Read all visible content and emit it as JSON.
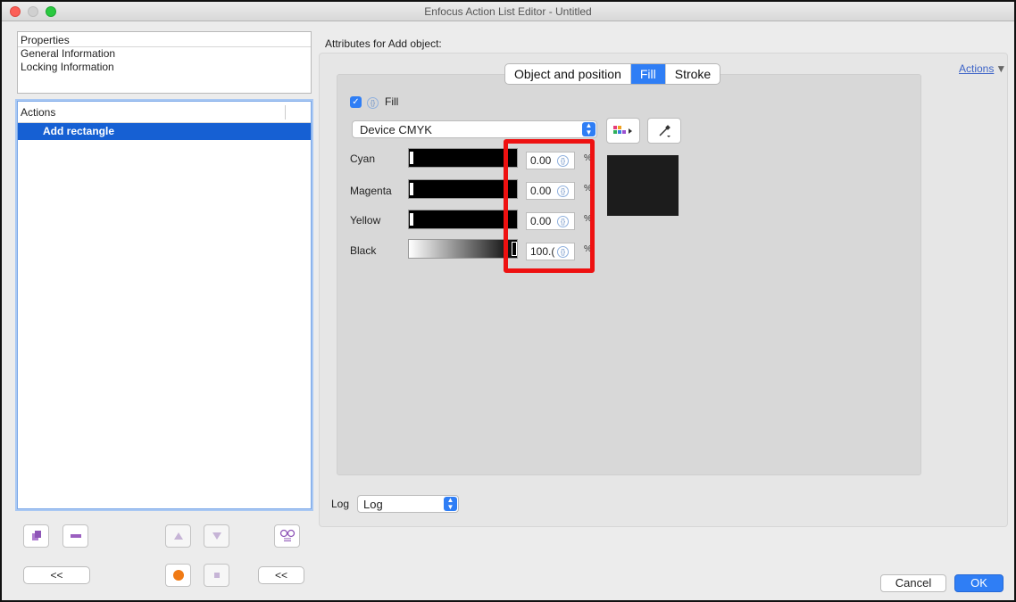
{
  "window": {
    "title": "Enfocus Action List Editor - Untitled"
  },
  "properties": {
    "header": "Properties",
    "items": [
      "General Information",
      "Locking Information"
    ]
  },
  "actions_list": {
    "header": "Actions",
    "items": [
      {
        "label": "Add rectangle",
        "selected": true
      }
    ]
  },
  "bottom_left": {
    "collapse_left": "<<",
    "collapse_right": "<<"
  },
  "panel": {
    "heading": "Attributes for Add object:",
    "actions_menu": "Actions",
    "tabs": [
      {
        "label": "Object and position",
        "active": false
      },
      {
        "label": "Fill",
        "active": true
      },
      {
        "label": "Stroke",
        "active": false
      }
    ],
    "fill": {
      "checked": true,
      "label": "Fill"
    },
    "color_space": "Device CMYK",
    "channels": [
      {
        "label": "Cyan",
        "value": "0.00",
        "unit": "%"
      },
      {
        "label": "Magenta",
        "value": "0.00",
        "unit": "%"
      },
      {
        "label": "Yellow",
        "value": "0.00",
        "unit": "%"
      },
      {
        "label": "Black",
        "value": "100.(",
        "unit": "%"
      }
    ],
    "swatch_color": "#1c1c1c"
  },
  "log": {
    "label": "Log",
    "value": "Log"
  },
  "dialog_buttons": {
    "cancel": "Cancel",
    "ok": "OK"
  },
  "colors": {
    "accent": "#2f7ef5",
    "highlight": "#ee1111",
    "selection": "#1660d3"
  }
}
